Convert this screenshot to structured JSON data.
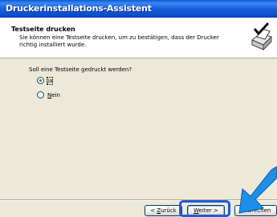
{
  "window": {
    "title": "Druckerinstallations-Assistent"
  },
  "header": {
    "title": "Testseite drucken",
    "subtitle": "Sie können eine Testseite drucken, um zu bestätigen, dass der Drucker richtig installiert wurde.",
    "icon": "printer-check-icon"
  },
  "main": {
    "question": "Soll eine Testseite gedruckt werden?",
    "options": [
      {
        "label_hotkey": "J",
        "label_rest": "a",
        "checked": true
      },
      {
        "label_hotkey": "N",
        "label_rest": "ein",
        "checked": false
      }
    ]
  },
  "buttons": {
    "back_prefix": "< ",
    "back_hotkey": "Z",
    "back_rest": "urück",
    "next_hotkey": "W",
    "next_rest": "eiter >",
    "cancel": "Abbrechen"
  },
  "colors": {
    "titlebar": "#0b4dcf",
    "highlight": "#1e5cd8",
    "arrow": "#1e8fe8"
  }
}
